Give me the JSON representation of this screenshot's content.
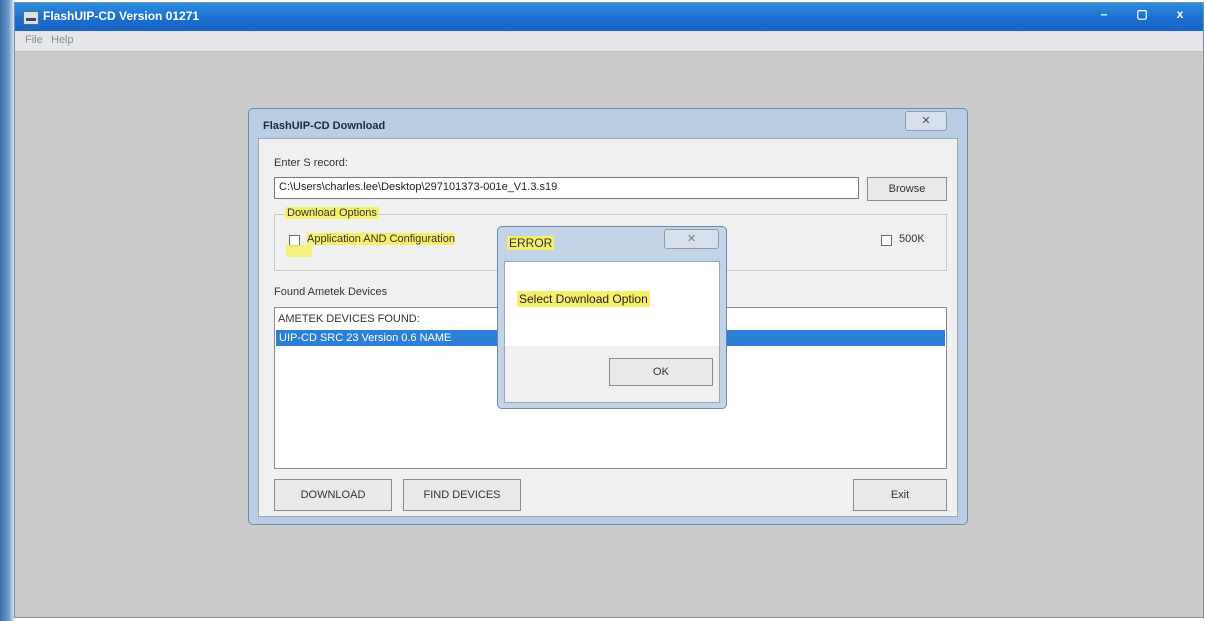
{
  "window": {
    "title": "FlashUIP-CD Version 01271",
    "controls": {
      "minimize": "–",
      "maximize": "▢",
      "close": "x"
    }
  },
  "menu": {
    "file": "File",
    "help": "Help"
  },
  "download_dialog": {
    "title": "FlashUIP-CD Download",
    "close": "✕",
    "srecord_label": "Enter S record:",
    "srecord_value": "C:\\Users\\charles.lee\\Desktop\\297101373-001e_V1.3.s19",
    "browse": "Browse",
    "options_legend": "Download Options",
    "app_config_label": "Application AND Configuration",
    "app_config_checked": false,
    "k500_label": "500K",
    "k500_checked": false,
    "found_label": "Found Ametek Devices",
    "list_header": "AMETEK DEVICES FOUND:",
    "devices": [
      "UIP-CD  SRC 23  Version  0.6  NAME"
    ],
    "download": "DOWNLOAD",
    "find_devices": "FIND DEVICES",
    "exit": "Exit"
  },
  "error_dialog": {
    "title": "ERROR",
    "close": "✕",
    "message": "Select Download Option",
    "ok": "OK"
  },
  "colors": {
    "titlebar": "#1b6ed0",
    "selection": "#2d7fd6",
    "highlight": "#f5ef6a"
  }
}
